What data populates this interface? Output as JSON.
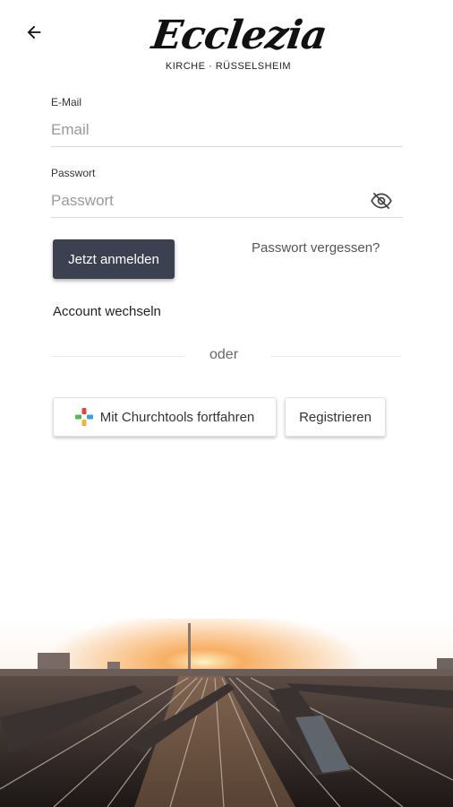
{
  "header": {
    "back_icon": "arrow-left-icon",
    "logo_text": "Ecclezia",
    "logo_subtitle": "KIRCHE · RÜSSELSHEIM"
  },
  "form": {
    "email_label": "E-Mail",
    "email_placeholder": "Email",
    "password_label": "Passwort",
    "password_placeholder": "Passwort",
    "visibility_icon": "eye-off-icon",
    "login_button": "Jetzt anmelden",
    "forgot_password": "Passwort vergessen?",
    "switch_account": "Account wechseln",
    "divider": "oder"
  },
  "alt_actions": {
    "churchtools_button": "Mit Churchtools fortfahren",
    "churchtools_icon": "churchtools-logo-icon",
    "register_button": "Registrieren"
  },
  "colors": {
    "primary_button": "#3b4150",
    "sunset": "#f5a04a"
  }
}
